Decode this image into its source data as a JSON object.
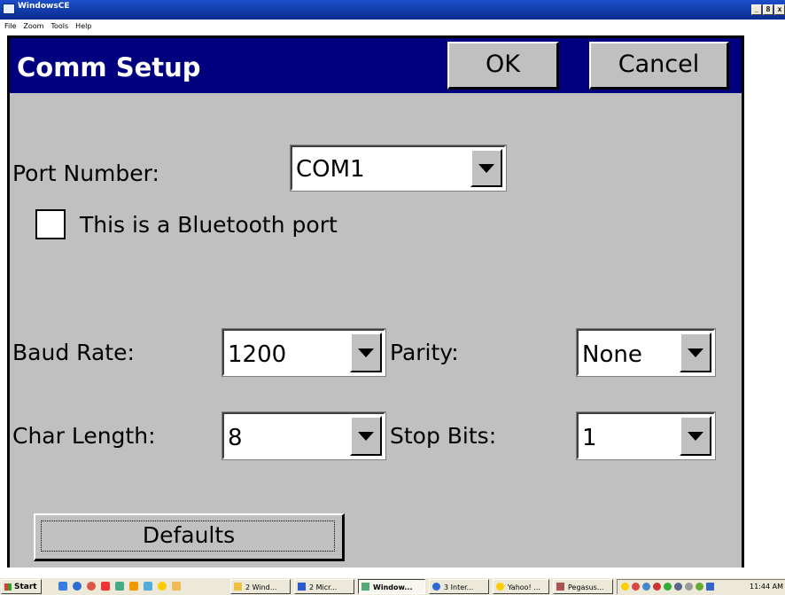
{
  "window": {
    "title": "WindowsCE",
    "controls": [
      "_",
      "8",
      "x"
    ]
  },
  "menubar": {
    "items": [
      "File",
      "Zoom",
      "Tools",
      "Help"
    ]
  },
  "dialog": {
    "title": "Comm Setup",
    "ok_label": "OK",
    "cancel_label": "Cancel",
    "port_number_label": "Port Number:",
    "port_number_value": "COM1",
    "bluetooth_label": "This is a Bluetooth port",
    "bluetooth_checked": false,
    "baud_rate_label": "Baud Rate:",
    "baud_rate_value": "1200",
    "parity_label": "Parity:",
    "parity_value": "None",
    "char_length_label": "Char Length:",
    "char_length_value": "8",
    "stop_bits_label": "Stop Bits:",
    "stop_bits_value": "1",
    "defaults_label": "Defaults"
  },
  "taskbar": {
    "start_label": "Start",
    "tasks": [
      "2 Wind...",
      "2 Micr...",
      "Window...",
      "3 Inter...",
      "Yahoo! ...",
      "Pegasus..."
    ],
    "clock": "11:44 AM"
  }
}
